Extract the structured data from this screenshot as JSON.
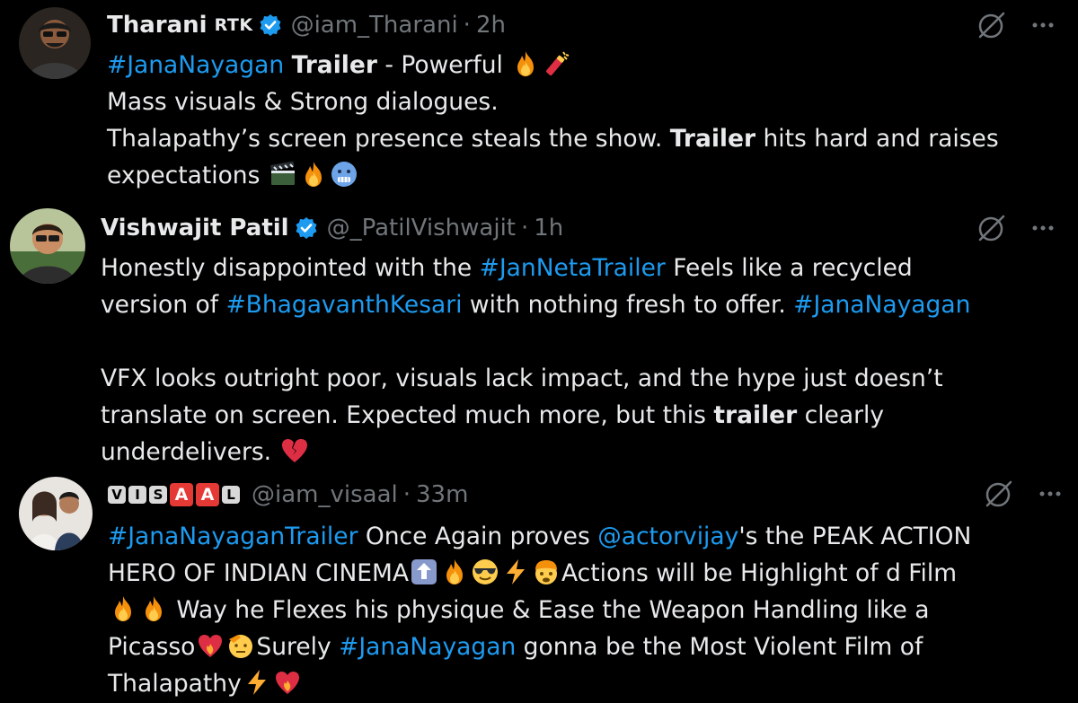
{
  "tweets": [
    {
      "name": "Tharani",
      "name_badge": "RTK",
      "handle": "@iam_Tharani",
      "time": "2h",
      "lines": [
        {
          "hashtag": "#JanaNayagan",
          "bold": "Trailer",
          "text": " - Powerful "
        },
        {
          "text": "Mass visuals & Strong dialogues."
        },
        {
          "text_a": "Thalapathy’s screen presence steals the show. ",
          "bold": "Trailer",
          "text_b": " hits hard and raises"
        },
        {
          "text": "expectations "
        }
      ]
    },
    {
      "name": "Vishwajit Patil",
      "handle": "@_PatilVishwajit",
      "time": "1h",
      "lines": [
        {
          "text_a": "Honestly disappointed with the ",
          "hashtag": "#JanNetaTrailer",
          "text_b": " Feels like a recycled"
        },
        {
          "text_a": "version of ",
          "hashtag": "#BhagavanthKesari",
          "text_b": " with nothing fresh to offer. ",
          "hashtag2": "#JanaNayagan"
        },
        {
          "text": "VFX looks outright poor, visuals lack impact, and the hype just doesn’t"
        },
        {
          "text_a": "translate on screen. Expected much more, but this ",
          "bold": "trailer",
          "text_b": " clearly"
        },
        {
          "text": "underdelivers. "
        }
      ]
    },
    {
      "name_letters": [
        "V",
        "I",
        "S",
        "A",
        "A",
        "L"
      ],
      "handle": "@iam_visaal",
      "time": "33m",
      "lines": [
        {
          "hashtag": "#JanaNayaganTrailer",
          "text_a": " Once Again proves ",
          "mention": "@actorvijay",
          "text_b": "'s the PEAK ACTION"
        },
        {
          "text_a": "HERO OF INDIAN CINEMA",
          "text_b": "Actions will be Highlight of d Film"
        },
        {
          "text": " Way he Flexes his physique & Ease the Weapon Handling like a"
        },
        {
          "text_a": "Picasso",
          "text_b": "Surely ",
          "hashtag": "#JanaNayagan",
          "text_c": " gonna be the Most Violent Film of"
        },
        {
          "text": "Thalapathy"
        }
      ]
    }
  ],
  "icons": {
    "verified": "verified-badge-icon",
    "grok": "grok-icon",
    "more": "more-options-icon"
  },
  "colors": {
    "background": "#000000",
    "text": "#e7e9ea",
    "muted": "#71767b",
    "link": "#1d9bf0",
    "verified": "#1d9bf0"
  }
}
